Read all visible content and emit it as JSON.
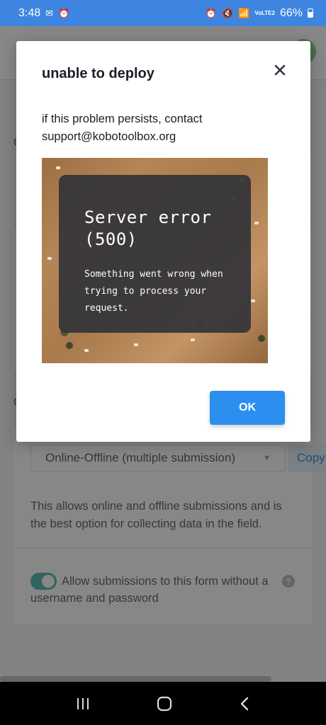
{
  "status_bar": {
    "time": "3:48",
    "battery": "66%",
    "network": "VoLTE2"
  },
  "background": {
    "section_letter_1": "C",
    "section_letter_2": "C",
    "submission_select": {
      "value": "Online-Offline (multiple submission)"
    },
    "copy_label": "Copy",
    "description": "This allows online and offline submissions and is the best option for collecting data in the field.",
    "allow_anonymous": {
      "label": "Allow submissions to this form without a username and password",
      "enabled": true
    },
    "help_icon": "?"
  },
  "modal": {
    "title": "unable to deploy",
    "message": "if this problem persists, contact support@kobotoolbox.org",
    "error_image": {
      "title": "Server error (500)",
      "body": "Something went wrong when trying to process your request."
    },
    "ok_label": "OK"
  },
  "icons": {
    "close": "close-icon",
    "nav_recent": "recent-apps-icon",
    "nav_home": "home-icon",
    "nav_back": "back-icon"
  },
  "colors": {
    "status_bar": "#3d85e0",
    "primary_button": "#2c8ff0",
    "toggle_on": "#59bfb1",
    "copy_text": "#3f8ee0"
  }
}
